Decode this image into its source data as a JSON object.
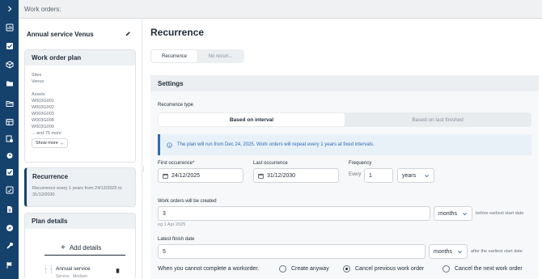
{
  "topbar": {
    "title": "Work orders:"
  },
  "sidebar": {
    "icons": [
      "chevron-right-icon",
      "chart-icon",
      "checkbox-icon",
      "box-icon",
      "folder-icon",
      "folder-open-icon",
      "layers-icon",
      "location-icon",
      "clock-icon",
      "checklist-icon",
      "document-check-icon",
      "file-icon",
      "compass-icon",
      "wrench-icon",
      "flag-icon"
    ]
  },
  "left": {
    "title": "Annual service Venus",
    "plan": {
      "heading": "Work order plan",
      "sites_label": "Sites",
      "site": "Venus",
      "assets_label": "Assets",
      "assets": [
        "W003G001",
        "W003G002",
        "W003G003",
        "W003G008",
        "W003G009"
      ],
      "more": "... and 75 more",
      "show_more": "Show more"
    },
    "recurrence": {
      "heading": "Recurrence",
      "text": "Recurrence every 1 years from 24/12/2025 to 31/12/2030"
    },
    "details": {
      "heading": "Plan details",
      "add": "Add details",
      "item_title": "Annual service",
      "item_sub": "Service · Medium"
    }
  },
  "main": {
    "title": "Recurrence",
    "tabs": [
      "Recurrence",
      "No recurr..."
    ],
    "settings": "Settings",
    "recurrence_type_label": "Recurrence type",
    "type_options": [
      "Based on interval",
      "Based on last finished"
    ],
    "info": "The plan will run from Dec 24, 2025. Work orders will repeat every 1 years at fixed intervals.",
    "first_label": "First occurrence*",
    "first_value": "24/12/2025",
    "last_label": "Last occurrence",
    "last_value": "31/12/2030",
    "freq_label": "Frequency",
    "freq_prefix": "Every",
    "freq_value": "1",
    "freq_unit": "years",
    "created_label": "Work orders will be created",
    "created_value": "3",
    "created_unit": "months",
    "created_suffix": "before earliest start date",
    "created_hint": "eg 1 Apr 2025",
    "finish_label": "Latest finish date",
    "finish_value": "5",
    "finish_unit": "months",
    "finish_suffix": "after the earliest start date",
    "cannot_label": "When you cannot complete a workorder.",
    "options": [
      "Create anyway",
      "Cancel previous work order",
      "Cancel the next work order"
    ]
  }
}
